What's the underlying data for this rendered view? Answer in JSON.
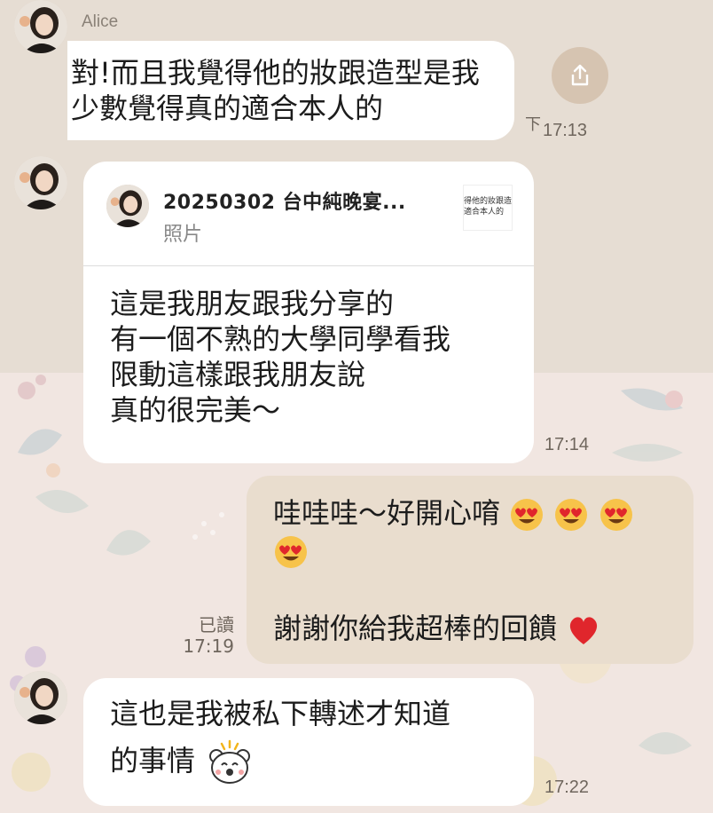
{
  "chat": {
    "sender_name": "Alice",
    "messages": [
      {
        "id": "m1",
        "direction": "in",
        "text": "對!而且我覺得他的妝跟造型是我\n少數覺得真的適合本人的",
        "time": "17:13",
        "trailing_char": "下"
      },
      {
        "id": "m2",
        "direction": "in",
        "reply": {
          "title": "20250302 台中純晚宴...",
          "subtitle": "照片",
          "thumb_text": "得他的妝跟造\n適合本人的"
        },
        "text": "這是我朋友跟我分享的\n有一個不熟的大學同學看我\n限動這樣跟我朋友說\n真的很完美～",
        "time": "17:14"
      },
      {
        "id": "m3",
        "direction": "out",
        "line1": "哇哇哇～好開心唷",
        "line3": "謝謝你給我超棒的回饋",
        "read_label": "已讀",
        "time": "17:19"
      },
      {
        "id": "m4",
        "direction": "in",
        "line1": "這也是我被私下轉述才知道",
        "line2": "的事情",
        "time": "17:22"
      }
    ]
  },
  "icons": {
    "share": "share-icon",
    "heart_eyes": "heart-eyes-emoji",
    "heart": "red-heart-emoji",
    "bear": "bear-sticker-emoji"
  },
  "colors": {
    "incoming_bubble": "#ffffff",
    "outgoing_bubble": "#e9ddce",
    "share_button": "#d6c4b1",
    "heart": "#e0262c"
  }
}
